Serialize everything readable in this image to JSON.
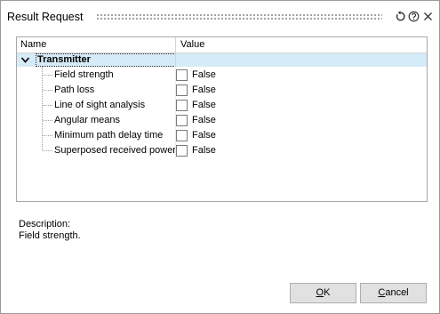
{
  "window": {
    "title": "Result Request",
    "icons": [
      "reset-icon",
      "help-icon",
      "close-icon"
    ]
  },
  "grid": {
    "columns": {
      "name": "Name",
      "value": "Value"
    },
    "group": {
      "label": "Transmitter",
      "expanded": true
    },
    "rows": [
      {
        "label": "Field strength",
        "checked": false,
        "value": "False"
      },
      {
        "label": "Path loss",
        "checked": false,
        "value": "False"
      },
      {
        "label": "Line of sight analysis",
        "checked": false,
        "value": "False"
      },
      {
        "label": "Angular means",
        "checked": false,
        "value": "False"
      },
      {
        "label": "Minimum path delay time",
        "checked": false,
        "value": "False"
      },
      {
        "label": "Superposed received power",
        "checked": false,
        "value": "False"
      }
    ]
  },
  "description": {
    "label": "Description:",
    "text": "Field strength."
  },
  "buttons": {
    "ok_mnemonic": "O",
    "ok_rest": "K",
    "cancel_mnemonic": "C",
    "cancel_rest": "ancel"
  }
}
